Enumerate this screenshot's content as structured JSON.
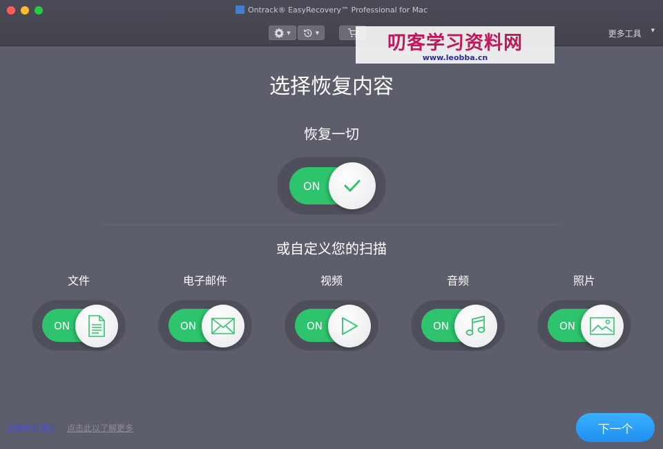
{
  "window": {
    "title": "Ontrack® EasyRecovery™ Professional for Mac"
  },
  "toolbar": {
    "more_tools": "更多工具"
  },
  "watermark": {
    "title": "叨客学习资料网",
    "url": "www.leobba.cn"
  },
  "main": {
    "title": "选择恢复内容",
    "recover_all": {
      "label": "恢复一切",
      "state": "ON"
    },
    "custom_label": "或自定义您的扫描",
    "categories": [
      {
        "label": "文件",
        "state": "ON",
        "icon": "file-icon"
      },
      {
        "label": "电子邮件",
        "state": "ON",
        "icon": "envelope-icon"
      },
      {
        "label": "视频",
        "state": "ON",
        "icon": "play-icon"
      },
      {
        "label": "音频",
        "state": "ON",
        "icon": "music-note-icon"
      },
      {
        "label": "照片",
        "state": "ON",
        "icon": "image-icon"
      }
    ]
  },
  "footer": {
    "create_disk": "创建恢复硬盘",
    "learn_more": "点击此以了解更多",
    "next": "下一个"
  },
  "colors": {
    "toggle_on": "#2ec46d",
    "next_button": "#2b9ff7",
    "background": "#5d5e6b"
  }
}
